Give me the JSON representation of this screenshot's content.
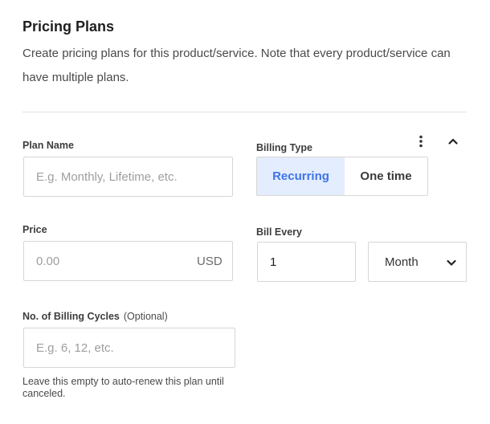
{
  "section": {
    "title": "Pricing Plans",
    "description": "Create pricing plans for this product/service. Note that every product/service can have multiple plans."
  },
  "plan_name": {
    "label": "Plan Name",
    "value": "",
    "placeholder": "E.g. Monthly, Lifetime, etc."
  },
  "billing_type": {
    "label": "Billing Type",
    "options": [
      "Recurring",
      "One time"
    ],
    "selected": "Recurring"
  },
  "price": {
    "label": "Price",
    "value": "",
    "placeholder": "0.00",
    "currency": "USD"
  },
  "bill_every": {
    "label": "Bill Every",
    "value": "1",
    "unit_selected": "Month"
  },
  "billing_cycles": {
    "label": "No. of Billing Cycles",
    "optional_label": "(Optional)",
    "value": "",
    "placeholder": "E.g. 6, 12, etc.",
    "help_text": "Leave this empty to auto-renew this plan until canceled."
  },
  "icons": {
    "menu": "more-vertical-icon",
    "collapse": "chevron-up-icon",
    "dropdown": "chevron-down-icon"
  },
  "colors": {
    "accent": "#3f73e8",
    "accent_bg": "#e3edfd",
    "border": "#d6d6d6"
  }
}
